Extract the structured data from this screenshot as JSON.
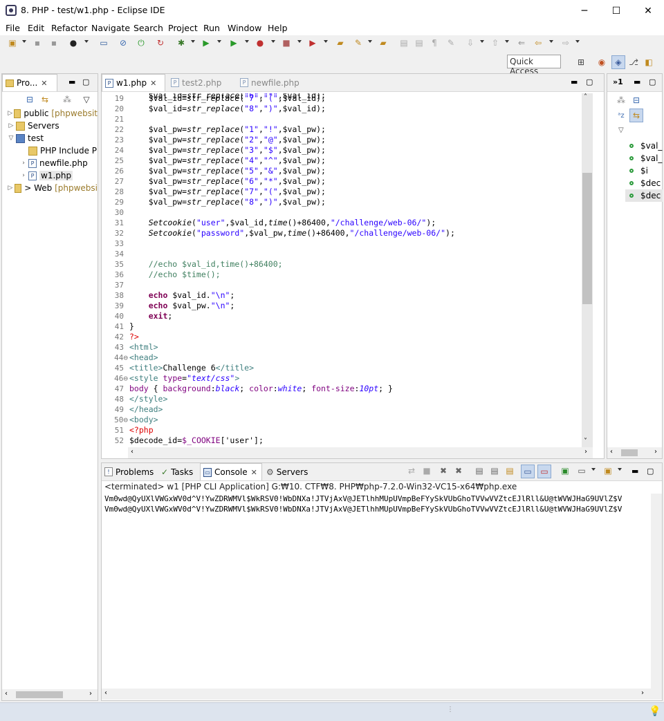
{
  "window": {
    "title": "8. PHP - test/w1.php - Eclipse IDE",
    "controls": {
      "minimize": "─",
      "maximize": "☐",
      "close": "✕"
    }
  },
  "menu": [
    "File",
    "Edit",
    "Refactor",
    "Navigate",
    "Search",
    "Project",
    "Run",
    "Window",
    "Help"
  ],
  "quick_access": "Quick Access",
  "project_explorer": {
    "tab_label": "Pro...",
    "items": [
      {
        "label": "public",
        "decoration": "[phpwebsit"
      },
      {
        "label": "Servers"
      },
      {
        "label": "test"
      },
      {
        "label": "PHP Include P"
      },
      {
        "label": "newfile.php"
      },
      {
        "label": "w1.php"
      },
      {
        "label": "> Web",
        "decoration": "[phpwebsi"
      }
    ]
  },
  "editor": {
    "tabs": [
      {
        "label": "w1.php",
        "active": true
      },
      {
        "label": "test2.php",
        "active": false
      },
      {
        "label": "newfile.php",
        "active": false
      }
    ],
    "line_numbers": [
      "19",
      "20",
      "21",
      "22",
      "23",
      "24",
      "25",
      "26",
      "27",
      "28",
      "29",
      "30",
      "31",
      "32",
      "33",
      "34",
      "35",
      "36",
      "37",
      "38",
      "39",
      "40",
      "41",
      "42",
      "43",
      "44",
      "45",
      "46",
      "47",
      "48",
      "49",
      "50",
      "51",
      "52"
    ],
    "fold_markers": [
      "44",
      "46",
      "50"
    ]
  },
  "outline": {
    "tab_label": "»1",
    "items": [
      "$val_",
      "$val_",
      "$i",
      "$dec",
      "$dec"
    ]
  },
  "console": {
    "tabs": [
      "Problems",
      "Tasks",
      "Console",
      "Servers"
    ],
    "header": "<terminated> w1 [PHP CLI Application] G:₩10. CTF₩8. PHP₩php-7.2.0-Win32-VC15-x64₩php.exe",
    "output": [
      "Vm0wd@QyUXlVWGxWV0d^V!YwZDRWMVl$WkRSV0!WbDNXa!JTVjAxV@JETlhhMUpUVmpBeFYySkVUbGhoTVVwVVZtcEJlRll&U@tWVWJHaG9UVlZ$V",
      "Vm0wd@QyUXlVWGxWV0d^V!YwZDRWMVl$WkRSV0!WbDNXa!JTVjAxV@JETlhhMUpUVmpBeFYySkVUbGhoTVVwVVZtcEJlRll&U@tWVWJHaG9UVlZ$V"
    ]
  }
}
